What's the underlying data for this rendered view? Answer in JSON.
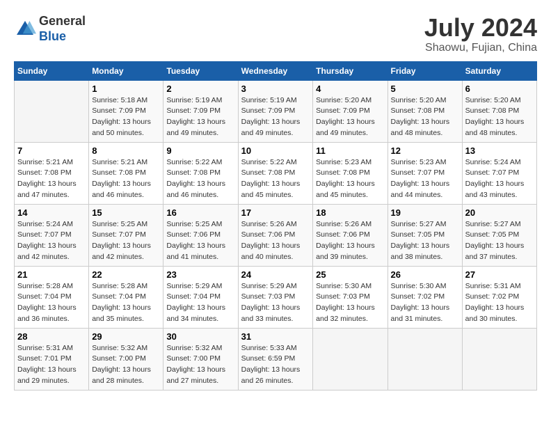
{
  "header": {
    "logo_line1": "General",
    "logo_line2": "Blue",
    "month_year": "July 2024",
    "location": "Shaowu, Fujian, China"
  },
  "weekdays": [
    "Sunday",
    "Monday",
    "Tuesday",
    "Wednesday",
    "Thursday",
    "Friday",
    "Saturday"
  ],
  "weeks": [
    [
      {
        "day": "",
        "sunrise": "",
        "sunset": "",
        "daylight": ""
      },
      {
        "day": "1",
        "sunrise": "Sunrise: 5:18 AM",
        "sunset": "Sunset: 7:09 PM",
        "daylight": "Daylight: 13 hours and 50 minutes."
      },
      {
        "day": "2",
        "sunrise": "Sunrise: 5:19 AM",
        "sunset": "Sunset: 7:09 PM",
        "daylight": "Daylight: 13 hours and 49 minutes."
      },
      {
        "day": "3",
        "sunrise": "Sunrise: 5:19 AM",
        "sunset": "Sunset: 7:09 PM",
        "daylight": "Daylight: 13 hours and 49 minutes."
      },
      {
        "day": "4",
        "sunrise": "Sunrise: 5:20 AM",
        "sunset": "Sunset: 7:09 PM",
        "daylight": "Daylight: 13 hours and 49 minutes."
      },
      {
        "day": "5",
        "sunrise": "Sunrise: 5:20 AM",
        "sunset": "Sunset: 7:08 PM",
        "daylight": "Daylight: 13 hours and 48 minutes."
      },
      {
        "day": "6",
        "sunrise": "Sunrise: 5:20 AM",
        "sunset": "Sunset: 7:08 PM",
        "daylight": "Daylight: 13 hours and 48 minutes."
      }
    ],
    [
      {
        "day": "7",
        "sunrise": "Sunrise: 5:21 AM",
        "sunset": "Sunset: 7:08 PM",
        "daylight": "Daylight: 13 hours and 47 minutes."
      },
      {
        "day": "8",
        "sunrise": "Sunrise: 5:21 AM",
        "sunset": "Sunset: 7:08 PM",
        "daylight": "Daylight: 13 hours and 46 minutes."
      },
      {
        "day": "9",
        "sunrise": "Sunrise: 5:22 AM",
        "sunset": "Sunset: 7:08 PM",
        "daylight": "Daylight: 13 hours and 46 minutes."
      },
      {
        "day": "10",
        "sunrise": "Sunrise: 5:22 AM",
        "sunset": "Sunset: 7:08 PM",
        "daylight": "Daylight: 13 hours and 45 minutes."
      },
      {
        "day": "11",
        "sunrise": "Sunrise: 5:23 AM",
        "sunset": "Sunset: 7:08 PM",
        "daylight": "Daylight: 13 hours and 45 minutes."
      },
      {
        "day": "12",
        "sunrise": "Sunrise: 5:23 AM",
        "sunset": "Sunset: 7:07 PM",
        "daylight": "Daylight: 13 hours and 44 minutes."
      },
      {
        "day": "13",
        "sunrise": "Sunrise: 5:24 AM",
        "sunset": "Sunset: 7:07 PM",
        "daylight": "Daylight: 13 hours and 43 minutes."
      }
    ],
    [
      {
        "day": "14",
        "sunrise": "Sunrise: 5:24 AM",
        "sunset": "Sunset: 7:07 PM",
        "daylight": "Daylight: 13 hours and 42 minutes."
      },
      {
        "day": "15",
        "sunrise": "Sunrise: 5:25 AM",
        "sunset": "Sunset: 7:07 PM",
        "daylight": "Daylight: 13 hours and 42 minutes."
      },
      {
        "day": "16",
        "sunrise": "Sunrise: 5:25 AM",
        "sunset": "Sunset: 7:06 PM",
        "daylight": "Daylight: 13 hours and 41 minutes."
      },
      {
        "day": "17",
        "sunrise": "Sunrise: 5:26 AM",
        "sunset": "Sunset: 7:06 PM",
        "daylight": "Daylight: 13 hours and 40 minutes."
      },
      {
        "day": "18",
        "sunrise": "Sunrise: 5:26 AM",
        "sunset": "Sunset: 7:06 PM",
        "daylight": "Daylight: 13 hours and 39 minutes."
      },
      {
        "day": "19",
        "sunrise": "Sunrise: 5:27 AM",
        "sunset": "Sunset: 7:05 PM",
        "daylight": "Daylight: 13 hours and 38 minutes."
      },
      {
        "day": "20",
        "sunrise": "Sunrise: 5:27 AM",
        "sunset": "Sunset: 7:05 PM",
        "daylight": "Daylight: 13 hours and 37 minutes."
      }
    ],
    [
      {
        "day": "21",
        "sunrise": "Sunrise: 5:28 AM",
        "sunset": "Sunset: 7:04 PM",
        "daylight": "Daylight: 13 hours and 36 minutes."
      },
      {
        "day": "22",
        "sunrise": "Sunrise: 5:28 AM",
        "sunset": "Sunset: 7:04 PM",
        "daylight": "Daylight: 13 hours and 35 minutes."
      },
      {
        "day": "23",
        "sunrise": "Sunrise: 5:29 AM",
        "sunset": "Sunset: 7:04 PM",
        "daylight": "Daylight: 13 hours and 34 minutes."
      },
      {
        "day": "24",
        "sunrise": "Sunrise: 5:29 AM",
        "sunset": "Sunset: 7:03 PM",
        "daylight": "Daylight: 13 hours and 33 minutes."
      },
      {
        "day": "25",
        "sunrise": "Sunrise: 5:30 AM",
        "sunset": "Sunset: 7:03 PM",
        "daylight": "Daylight: 13 hours and 32 minutes."
      },
      {
        "day": "26",
        "sunrise": "Sunrise: 5:30 AM",
        "sunset": "Sunset: 7:02 PM",
        "daylight": "Daylight: 13 hours and 31 minutes."
      },
      {
        "day": "27",
        "sunrise": "Sunrise: 5:31 AM",
        "sunset": "Sunset: 7:02 PM",
        "daylight": "Daylight: 13 hours and 30 minutes."
      }
    ],
    [
      {
        "day": "28",
        "sunrise": "Sunrise: 5:31 AM",
        "sunset": "Sunset: 7:01 PM",
        "daylight": "Daylight: 13 hours and 29 minutes."
      },
      {
        "day": "29",
        "sunrise": "Sunrise: 5:32 AM",
        "sunset": "Sunset: 7:00 PM",
        "daylight": "Daylight: 13 hours and 28 minutes."
      },
      {
        "day": "30",
        "sunrise": "Sunrise: 5:32 AM",
        "sunset": "Sunset: 7:00 PM",
        "daylight": "Daylight: 13 hours and 27 minutes."
      },
      {
        "day": "31",
        "sunrise": "Sunrise: 5:33 AM",
        "sunset": "Sunset: 6:59 PM",
        "daylight": "Daylight: 13 hours and 26 minutes."
      },
      {
        "day": "",
        "sunrise": "",
        "sunset": "",
        "daylight": ""
      },
      {
        "day": "",
        "sunrise": "",
        "sunset": "",
        "daylight": ""
      },
      {
        "day": "",
        "sunrise": "",
        "sunset": "",
        "daylight": ""
      }
    ]
  ]
}
